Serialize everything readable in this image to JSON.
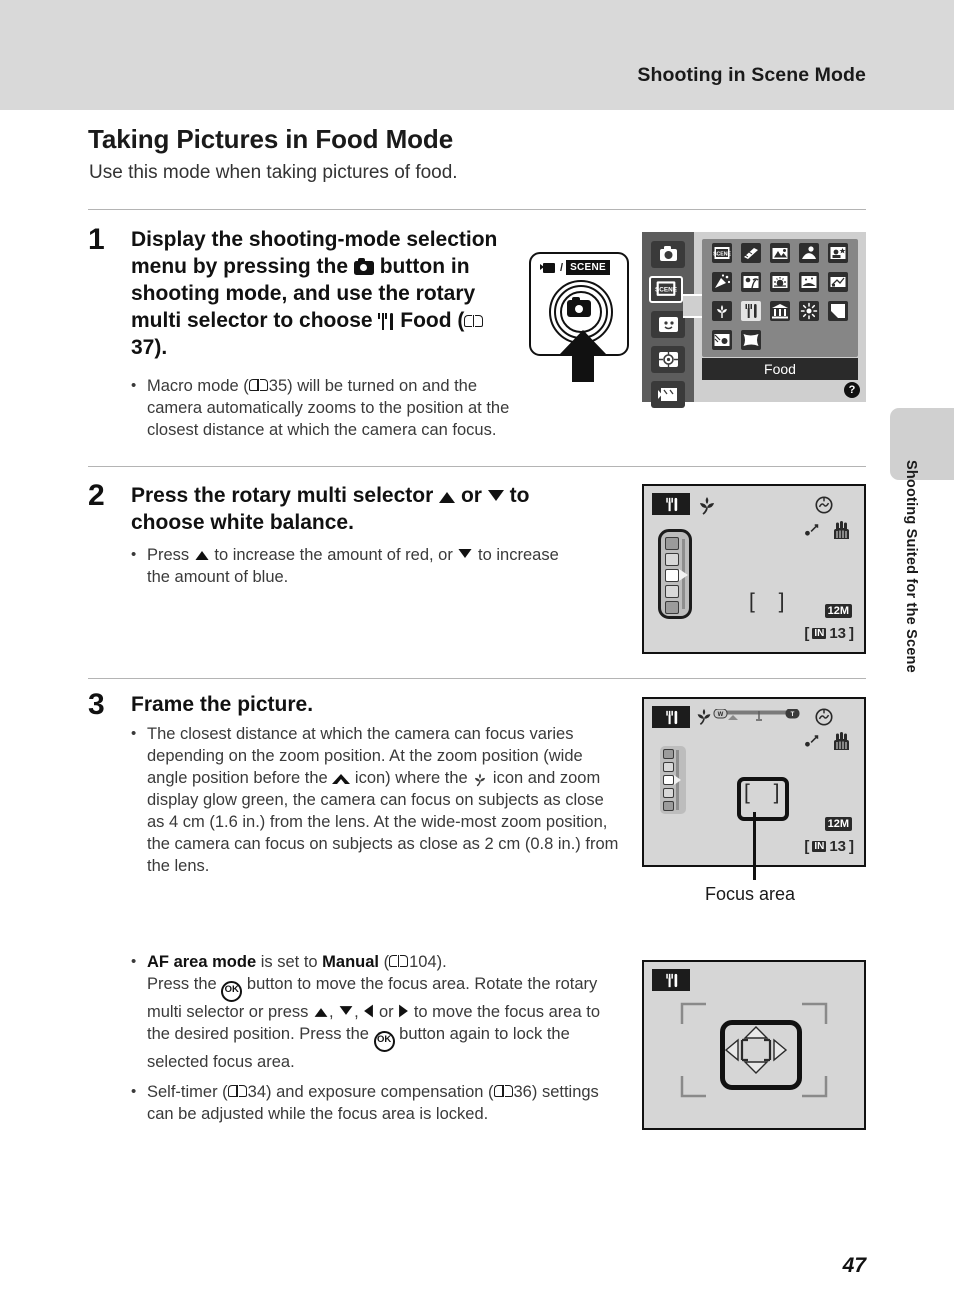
{
  "header": {
    "running_head": "Shooting in Scene Mode"
  },
  "side_tab": {
    "label": "Shooting Suited for the Scene"
  },
  "page": {
    "title": "Taking Pictures in Food Mode",
    "intro": "Use this mode when taking pictures of food.",
    "number": "47"
  },
  "steps": [
    {
      "number": "1",
      "heading_part1": "Display the shooting-mode selection menu by pressing the",
      "heading_part2": "button in shooting mode, and use the rotary multi selector to choose",
      "heading_mode": "Food",
      "heading_ref": "37",
      "heading_tail": ").",
      "bullets": [
        {
          "pre": "Macro mode (",
          "ref": "35",
          "post": ") will be turned on and the camera automatically zooms to the position at the closest distance at which the camera can focus."
        }
      ]
    },
    {
      "number": "2",
      "heading_pre": "Press the rotary multi selector",
      "heading_mid": "or",
      "heading_post": "to choose white balance.",
      "bullets": [
        {
          "pre": "Press",
          "mid": "to increase the amount of red, or",
          "post": "to increase the amount of blue."
        }
      ]
    },
    {
      "number": "3",
      "heading": "Frame the picture.",
      "bullet_zoom": {
        "part1": "The closest distance at which the camera can focus varies depending on the zoom position. At the zoom position (wide angle position before the",
        "part2": "icon) where the",
        "part3": "icon and zoom display glow green, the camera can focus on subjects as close as 4 cm (1.6 in.) from the lens. At the wide-most zoom position, the camera can focus on subjects as close as 2 cm (0.8 in.) from the lens."
      },
      "bullet_af": {
        "bold1": "AF area mode",
        "mid1": "is set to",
        "bold2": "Manual",
        "ref": "104",
        "tail1": ").",
        "line2a": "Press the",
        "line2b": "button to move the focus area. Rotate the rotary multi selector or press",
        "line2c": ",",
        "line2d": ",",
        "line2e": "or",
        "line2f": "to move the focus area to the desired position. Press the",
        "line2g": "button again to lock the selected focus area."
      },
      "bullet_timer": {
        "pre": "Self-timer (",
        "ref1": "34",
        "mid": ") and exposure compensation (",
        "ref2": "36",
        "post": ") settings can be adjusted while the focus area is locked."
      }
    }
  ],
  "button_diagram": {
    "movie_label": "movie-icon",
    "scene_label": "SCENE",
    "separator": "/"
  },
  "scene_menu": {
    "caption": "Food",
    "help_badge": "?",
    "left_tabs": [
      "auto-mode-tab",
      "scene-mode-tab",
      "smart-portrait-tab",
      "subject-tracking-tab",
      "movie-mode-tab"
    ],
    "selected_tab_index": 1,
    "grid_rows": [
      5,
      5,
      5,
      2
    ],
    "selected_cell": {
      "row": 2,
      "col": 1
    }
  },
  "lcd_screens": [
    {
      "id": "white-balance-screen",
      "mode_icon": "food-mode-icon",
      "icons": [
        "macro-icon",
        "vibration-reduction-icon",
        "motion-detection-icon",
        "blur-warning-icon"
      ],
      "image_size": "12M",
      "storage": "IN",
      "shots_remaining": "13",
      "wb_slider_positions": 5,
      "wb_selected_index": 2
    },
    {
      "id": "framing-screen",
      "mode_icon": "food-mode-icon",
      "icons": [
        "macro-icon",
        "zoom-indicator",
        "vibration-reduction-icon",
        "motion-detection-icon",
        "blur-warning-icon"
      ],
      "zoom_wide_label": "W",
      "zoom_tele_label": "T",
      "image_size": "12M",
      "storage": "IN",
      "shots_remaining": "13",
      "callout": "Focus area"
    },
    {
      "id": "focus-area-move-screen",
      "mode_icon": "food-mode-icon",
      "dpad": "four-way-move-indicator"
    }
  ],
  "colors": {
    "header_band": "#d9d9d9",
    "thumb_tab": "#d0d0d0",
    "lcd_background": "#d6d6d6",
    "menu_panel": "#cfcfcf",
    "menu_grid": "#868686",
    "ink": "#111111"
  }
}
